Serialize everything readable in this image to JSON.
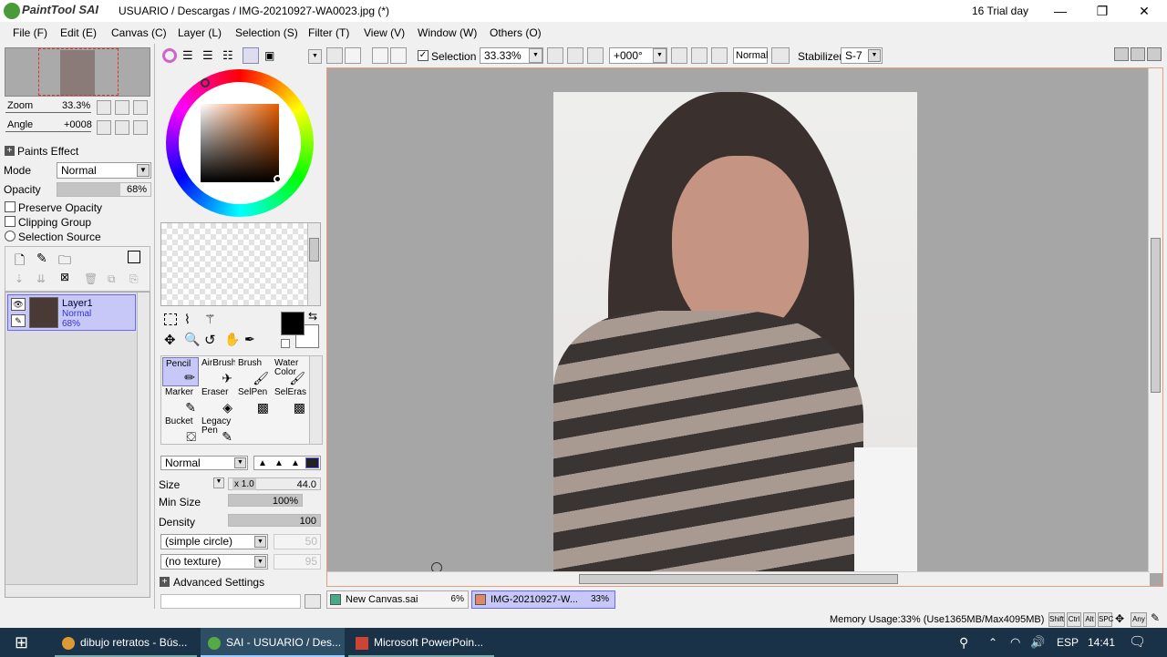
{
  "window": {
    "app_logo": "PaintTool SAI",
    "title": "USUARIO / Descargas / IMG-20210927-WA0023.jpg (*)",
    "trial": "16 Trial day",
    "minimize": "—",
    "restore": "❐",
    "close": "✕"
  },
  "menu": [
    "File (F)",
    "Edit (E)",
    "Canvas (C)",
    "Layer (L)",
    "Selection (S)",
    "Filter (T)",
    "View (V)",
    "Window (W)",
    "Others (O)"
  ],
  "navigator": {
    "zoom_label": "Zoom",
    "zoom_value": "33.3%",
    "angle_label": "Angle",
    "angle_value": "+0008"
  },
  "layer_props": {
    "paints_effect": "Paints Effect",
    "mode_label": "Mode",
    "mode_value": "Normal",
    "opacity_label": "Opacity",
    "opacity_value": "68%",
    "opacity_level": 0.68,
    "preserve_opacity": "Preserve Opacity",
    "clipping_group": "Clipping Group",
    "selection_source": "Selection Source"
  },
  "layers": [
    {
      "name": "Layer1",
      "mode": "Normal",
      "opacity": "68%"
    }
  ],
  "toolbar": {
    "selection_label": "Selection",
    "zoom_value": "33.33%",
    "angle_value": "+000°",
    "blend_value": "Normal",
    "stabilizer_label": "Stabilizer",
    "stabilizer_value": "S-7"
  },
  "tools": [
    {
      "label": "Pencil",
      "icon": "pencil-icon"
    },
    {
      "label": "AirBrush",
      "icon": "airbrush-icon"
    },
    {
      "label": "Brush",
      "icon": "brush-icon"
    },
    {
      "label": "Water Color",
      "icon": "watercolor-icon"
    },
    {
      "label": "Marker",
      "icon": "marker-icon"
    },
    {
      "label": "Eraser",
      "icon": "eraser-icon"
    },
    {
      "label": "SelPen",
      "icon": "selpen-icon"
    },
    {
      "label": "SelEras",
      "icon": "seleras-icon"
    },
    {
      "label": "Bucket",
      "icon": "bucket-icon"
    },
    {
      "label": "Legacy Pen",
      "icon": "legacy-pen-icon"
    }
  ],
  "brush": {
    "blend_mode": "Normal",
    "size_label": "Size",
    "size_mult": "x 1.0",
    "size_value": "44.0",
    "min_size_label": "Min Size",
    "min_size_value": "100%",
    "density_label": "Density",
    "density_value": "100",
    "shape": "(simple circle)",
    "shape_value": "50",
    "texture": "(no texture)",
    "texture_value": "95",
    "advanced": "Advanced Settings"
  },
  "colors": {
    "primary": "#000000",
    "secondary": "#ffffff",
    "accent": "#c8c8f8"
  },
  "canvas_tabs": [
    {
      "name": "New Canvas.sai",
      "zoom": "6%"
    },
    {
      "name": "IMG-20210927-W...",
      "zoom": "33%"
    }
  ],
  "status": {
    "memory": "Memory Usage:33% (Use1365MB/Max4095MB)",
    "keys": [
      "Shift",
      "Ctrl",
      "Alt",
      "SPC",
      "Any"
    ]
  },
  "taskbar": {
    "items": [
      "dibujo retratos - Bús...",
      "SAI - USUARIO / Des...",
      "Microsoft PowerPoin..."
    ],
    "language": "ESP",
    "time": "14:41"
  }
}
